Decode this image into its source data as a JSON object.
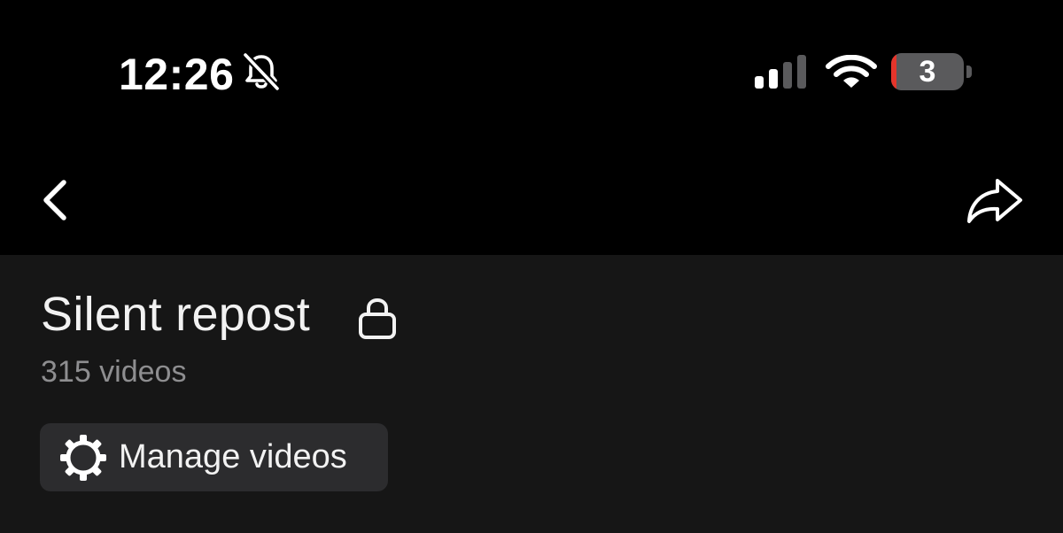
{
  "status_bar": {
    "time": "12:26",
    "silent_icon": "bell-slash-icon",
    "signal_icon": "cellular-signal-icon",
    "signal_bars_active": 2,
    "signal_bars_total": 4,
    "wifi_icon": "wifi-icon",
    "battery_level": "3",
    "battery_fraction": 0.03,
    "battery_low_color": "#e5352b"
  },
  "nav": {
    "back_icon": "chevron-left-icon",
    "share_icon": "share-arrow-icon"
  },
  "playlist": {
    "title": "Silent repost",
    "lock_icon": "lock-icon",
    "video_count": "315 videos",
    "manage_button": {
      "label": "Manage videos",
      "icon": "gear-icon"
    }
  },
  "colors": {
    "background_top": "#000000",
    "background_content": "#161616",
    "button_background": "#2c2c2e",
    "secondary_text": "#8e8e90"
  }
}
